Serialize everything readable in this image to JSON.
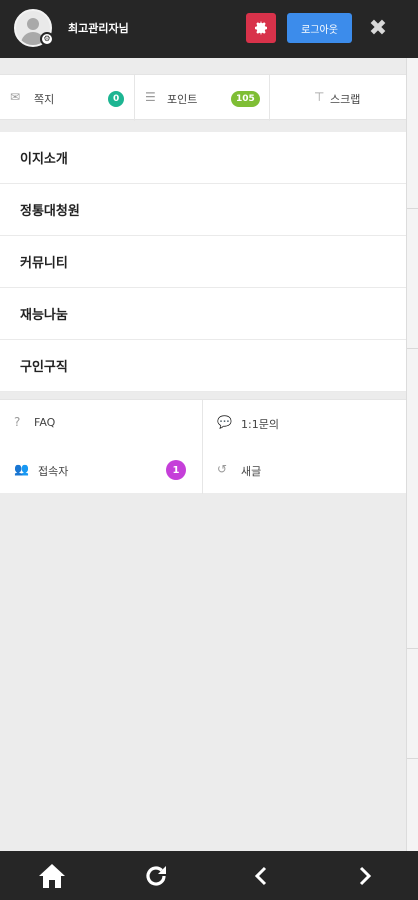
{
  "header": {
    "username": "최고관리자님",
    "logout_label": "로그아웃",
    "settings_icon": "gear-icon",
    "close_icon": "close-icon"
  },
  "quick_links": [
    {
      "label": "쪽지",
      "icon": "envelope-icon",
      "badge": "0",
      "badge_color": "#1db592"
    },
    {
      "label": "포인트",
      "icon": "database-icon",
      "badge": "105",
      "badge_color": "#7fbe35"
    },
    {
      "label": "스크랩",
      "icon": "pin-icon"
    }
  ],
  "menu": [
    {
      "label": "이지소개"
    },
    {
      "label": "정통대청원"
    },
    {
      "label": "커뮤니티"
    },
    {
      "label": "재능나눔"
    },
    {
      "label": "구인구직"
    }
  ],
  "grid": [
    {
      "label": "FAQ",
      "icon": "question-icon"
    },
    {
      "label": "1:1문의",
      "icon": "chat-icon"
    },
    {
      "label": "접속자",
      "icon": "users-icon",
      "badge": "1",
      "badge_color": "#c53fd9"
    },
    {
      "label": "새글",
      "icon": "refresh-icon"
    }
  ],
  "bottom_nav": [
    {
      "name": "home",
      "icon": "home-icon"
    },
    {
      "name": "refresh",
      "icon": "refresh-icon"
    },
    {
      "name": "back",
      "icon": "chevron-left-icon"
    },
    {
      "name": "forward",
      "icon": "chevron-right-icon"
    }
  ]
}
